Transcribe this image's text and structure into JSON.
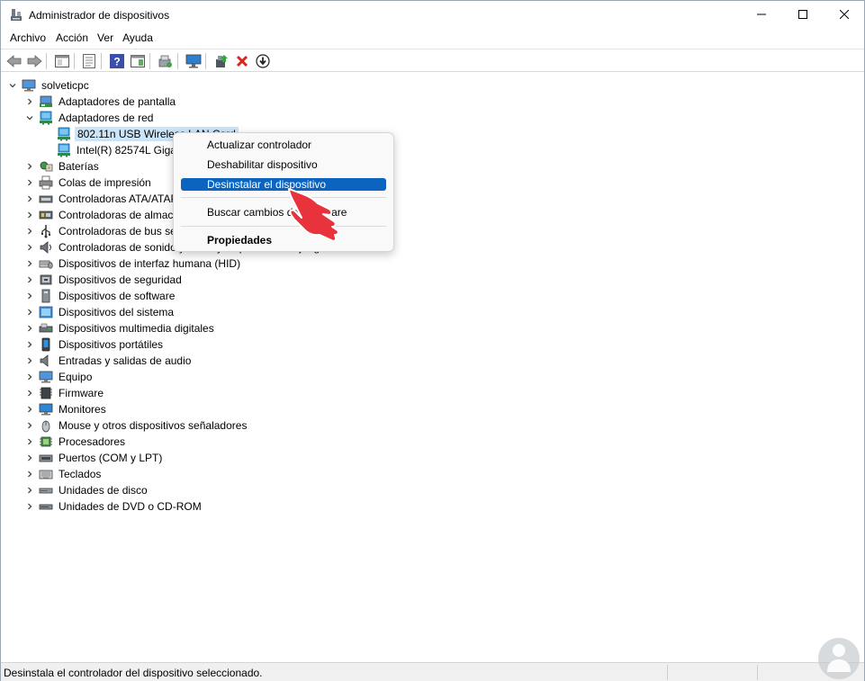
{
  "window": {
    "title": "Administrador de dispositivos"
  },
  "menubar": [
    "Archivo",
    "Acción",
    "Ver",
    "Ayuda"
  ],
  "toolbar": {
    "buttons": [
      "back-icon",
      "forward-icon",
      "show-hide-tree-icon",
      "properties-icon",
      "help-icon",
      "action-pane-icon",
      "scan-hardware-icon",
      "monitor-icon",
      "update-driver-icon",
      "uninstall-icon",
      "download-icon"
    ]
  },
  "tree": {
    "root": "solveticpc",
    "categories": [
      {
        "label": "Adaptadores de pantalla",
        "icon": "display-adapter-icon",
        "expanded": false
      },
      {
        "label": "Adaptadores de red",
        "icon": "network-adapter-icon",
        "expanded": true,
        "children": [
          {
            "label": "802.11n USB Wireless LAN Card",
            "icon": "network-adapter-icon",
            "selected": true
          },
          {
            "label": "Intel(R) 82574L Gigabit Network Connection",
            "icon": "network-adapter-icon",
            "selected": false
          }
        ]
      },
      {
        "label": "Baterías",
        "icon": "battery-icon",
        "expanded": false
      },
      {
        "label": "Colas de impresión",
        "icon": "printer-icon",
        "expanded": false
      },
      {
        "label": "Controladoras ATA/ATAPI IDE",
        "icon": "ide-controller-icon",
        "expanded": false
      },
      {
        "label": "Controladoras de almacenamiento",
        "icon": "storage-controller-icon",
        "expanded": false
      },
      {
        "label": "Controladoras de bus serie universal",
        "icon": "usb-icon",
        "expanded": false
      },
      {
        "label": "Controladoras de sonido y vídeo y dispositivos de juego",
        "icon": "sound-icon",
        "expanded": false
      },
      {
        "label": "Dispositivos de interfaz humana (HID)",
        "icon": "hid-icon",
        "expanded": false
      },
      {
        "label": "Dispositivos de seguridad",
        "icon": "security-device-icon",
        "expanded": false
      },
      {
        "label": "Dispositivos de software",
        "icon": "software-device-icon",
        "expanded": false
      },
      {
        "label": "Dispositivos del sistema",
        "icon": "system-device-icon",
        "expanded": false
      },
      {
        "label": "Dispositivos multimedia digitales",
        "icon": "multimedia-icon",
        "expanded": false
      },
      {
        "label": "Dispositivos portátiles",
        "icon": "portable-device-icon",
        "expanded": false
      },
      {
        "label": "Entradas y salidas de audio",
        "icon": "audio-io-icon",
        "expanded": false
      },
      {
        "label": "Equipo",
        "icon": "computer-icon",
        "expanded": false
      },
      {
        "label": "Firmware",
        "icon": "firmware-icon",
        "expanded": false
      },
      {
        "label": "Monitores",
        "icon": "monitor-icon",
        "expanded": false
      },
      {
        "label": "Mouse y otros dispositivos señaladores",
        "icon": "mouse-icon",
        "expanded": false
      },
      {
        "label": "Procesadores",
        "icon": "processor-icon",
        "expanded": false
      },
      {
        "label": "Puertos (COM y LPT)",
        "icon": "port-icon",
        "expanded": false
      },
      {
        "label": "Teclados",
        "icon": "keyboard-icon",
        "expanded": false
      },
      {
        "label": "Unidades de disco",
        "icon": "disk-drive-icon",
        "expanded": false
      },
      {
        "label": "Unidades de DVD o CD-ROM",
        "icon": "dvd-drive-icon",
        "expanded": false
      }
    ]
  },
  "context_menu": {
    "items": [
      {
        "label": "Actualizar controlador",
        "highlighted": false,
        "bold": false
      },
      {
        "label": "Deshabilitar dispositivo",
        "highlighted": false,
        "bold": false
      },
      {
        "label": "Desinstalar el dispositivo",
        "highlighted": true,
        "bold": false
      },
      {
        "label": "Buscar cambios de hardware",
        "highlighted": false,
        "bold": false
      },
      {
        "label": "Propiedades",
        "highlighted": false,
        "bold": true
      }
    ]
  },
  "statusbar": {
    "text": "Desinstala el controlador del dispositivo seleccionado."
  },
  "colors": {
    "highlight": "#0b64c0",
    "selection": "#cce4f7",
    "pointer": "#e8323c",
    "uninstall": "#d9241f"
  }
}
